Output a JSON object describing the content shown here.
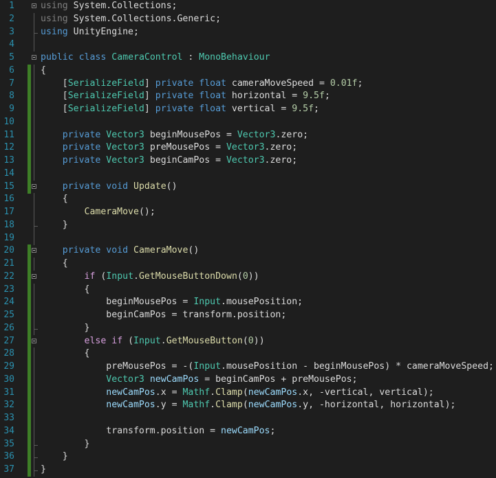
{
  "editor": {
    "language": "C#",
    "colors": {
      "background": "#1e1e1e",
      "line_number": "#2b91af",
      "keyword": "#569cd6",
      "type": "#4ec9b0",
      "number": "#b5cea8",
      "local": "#9cdcfe",
      "method": "#dcdcaa",
      "control": "#d8a0df",
      "changed_margin": "#3e7f27"
    },
    "lines": [
      {
        "n": "1",
        "tokens": [
          [
            "dim",
            "using"
          ],
          [
            "var",
            " System.Collections;"
          ]
        ]
      },
      {
        "n": "2",
        "tokens": [
          [
            "dim",
            "using"
          ],
          [
            "var",
            " System.Collections.Generic;"
          ]
        ]
      },
      {
        "n": "3",
        "tokens": [
          [
            "kw",
            "using"
          ],
          [
            "var",
            " UnityEngine;"
          ]
        ]
      },
      {
        "n": "4",
        "tokens": []
      },
      {
        "n": "5",
        "tokens": [
          [
            "kw",
            "public"
          ],
          [
            "var",
            " "
          ],
          [
            "kw",
            "class"
          ],
          [
            "var",
            " "
          ],
          [
            "ty",
            "CameraControl"
          ],
          [
            "var",
            " : "
          ],
          [
            "ty",
            "MonoBehaviour"
          ]
        ]
      },
      {
        "n": "6",
        "tokens": [
          [
            "var",
            "{"
          ]
        ]
      },
      {
        "n": "7",
        "tokens": [
          [
            "var",
            "    ["
          ],
          [
            "attr",
            "SerializeField"
          ],
          [
            "var",
            "] "
          ],
          [
            "kw",
            "private"
          ],
          [
            "var",
            " "
          ],
          [
            "kw",
            "float"
          ],
          [
            "var",
            " cameraMoveSpeed = "
          ],
          [
            "num",
            "0.01f"
          ],
          [
            "var",
            ";"
          ]
        ]
      },
      {
        "n": "8",
        "tokens": [
          [
            "var",
            "    ["
          ],
          [
            "attr",
            "SerializeField"
          ],
          [
            "var",
            "] "
          ],
          [
            "kw",
            "private"
          ],
          [
            "var",
            " "
          ],
          [
            "kw",
            "float"
          ],
          [
            "var",
            " horizontal = "
          ],
          [
            "num",
            "9.5f"
          ],
          [
            "var",
            ";"
          ]
        ]
      },
      {
        "n": "9",
        "tokens": [
          [
            "var",
            "    ["
          ],
          [
            "attr",
            "SerializeField"
          ],
          [
            "var",
            "] "
          ],
          [
            "kw",
            "private"
          ],
          [
            "var",
            " "
          ],
          [
            "kw",
            "float"
          ],
          [
            "var",
            " vertical = "
          ],
          [
            "num",
            "9.5f"
          ],
          [
            "var",
            ";"
          ]
        ]
      },
      {
        "n": "10",
        "tokens": []
      },
      {
        "n": "11",
        "tokens": [
          [
            "var",
            "    "
          ],
          [
            "kw",
            "private"
          ],
          [
            "var",
            " "
          ],
          [
            "ty",
            "Vector3"
          ],
          [
            "var",
            " beginMousePos = "
          ],
          [
            "ty",
            "Vector3"
          ],
          [
            "var",
            ".zero;"
          ]
        ]
      },
      {
        "n": "12",
        "tokens": [
          [
            "var",
            "    "
          ],
          [
            "kw",
            "private"
          ],
          [
            "var",
            " "
          ],
          [
            "ty",
            "Vector3"
          ],
          [
            "var",
            " preMousePos = "
          ],
          [
            "ty",
            "Vector3"
          ],
          [
            "var",
            ".zero;"
          ]
        ]
      },
      {
        "n": "13",
        "tokens": [
          [
            "var",
            "    "
          ],
          [
            "kw",
            "private"
          ],
          [
            "var",
            " "
          ],
          [
            "ty",
            "Vector3"
          ],
          [
            "var",
            " beginCamPos = "
          ],
          [
            "ty",
            "Vector3"
          ],
          [
            "var",
            ".zero;"
          ]
        ]
      },
      {
        "n": "14",
        "tokens": []
      },
      {
        "n": "15",
        "tokens": [
          [
            "var",
            "    "
          ],
          [
            "kw",
            "private"
          ],
          [
            "var",
            " "
          ],
          [
            "kw",
            "void"
          ],
          [
            "var",
            " "
          ],
          [
            "fn",
            "Update"
          ],
          [
            "var",
            "()"
          ]
        ]
      },
      {
        "n": "16",
        "tokens": [
          [
            "var",
            "    {"
          ]
        ]
      },
      {
        "n": "17",
        "tokens": [
          [
            "var",
            "        "
          ],
          [
            "fn",
            "CameraMove"
          ],
          [
            "var",
            "();"
          ]
        ]
      },
      {
        "n": "18",
        "tokens": [
          [
            "var",
            "    }"
          ]
        ]
      },
      {
        "n": "19",
        "tokens": []
      },
      {
        "n": "20",
        "tokens": [
          [
            "var",
            "    "
          ],
          [
            "kw",
            "private"
          ],
          [
            "var",
            " "
          ],
          [
            "kw",
            "void"
          ],
          [
            "var",
            " "
          ],
          [
            "fn",
            "CameraMove"
          ],
          [
            "var",
            "()"
          ]
        ]
      },
      {
        "n": "21",
        "tokens": [
          [
            "var",
            "    {"
          ]
        ]
      },
      {
        "n": "22",
        "tokens": [
          [
            "var",
            "        "
          ],
          [
            "ctl",
            "if"
          ],
          [
            "var",
            " ("
          ],
          [
            "ty",
            "Input"
          ],
          [
            "var",
            "."
          ],
          [
            "fn",
            "GetMouseButtonDown"
          ],
          [
            "var",
            "("
          ],
          [
            "num",
            "0"
          ],
          [
            "var",
            "))"
          ]
        ]
      },
      {
        "n": "23",
        "tokens": [
          [
            "var",
            "        {"
          ]
        ]
      },
      {
        "n": "24",
        "tokens": [
          [
            "var",
            "            beginMousePos = "
          ],
          [
            "ty",
            "Input"
          ],
          [
            "var",
            ".mousePosition;"
          ]
        ]
      },
      {
        "n": "25",
        "tokens": [
          [
            "var",
            "            beginCamPos = transform.position;"
          ]
        ]
      },
      {
        "n": "26",
        "tokens": [
          [
            "var",
            "        }"
          ]
        ]
      },
      {
        "n": "27",
        "tokens": [
          [
            "var",
            "        "
          ],
          [
            "ctl",
            "else"
          ],
          [
            "var",
            " "
          ],
          [
            "ctl",
            "if"
          ],
          [
            "var",
            " ("
          ],
          [
            "ty",
            "Input"
          ],
          [
            "var",
            "."
          ],
          [
            "fn",
            "GetMouseButton"
          ],
          [
            "var",
            "("
          ],
          [
            "num",
            "0"
          ],
          [
            "var",
            "))"
          ]
        ]
      },
      {
        "n": "28",
        "tokens": [
          [
            "var",
            "        {"
          ]
        ]
      },
      {
        "n": "29",
        "tokens": [
          [
            "var",
            "            preMousePos = -("
          ],
          [
            "ty",
            "Input"
          ],
          [
            "var",
            ".mousePosition - beginMousePos) * cameraMoveSpeed;"
          ]
        ]
      },
      {
        "n": "30",
        "tokens": [
          [
            "var",
            "            "
          ],
          [
            "ty",
            "Vector3"
          ],
          [
            "var",
            " "
          ],
          [
            "loc",
            "newCamPos"
          ],
          [
            "var",
            " = beginCamPos + preMousePos;"
          ]
        ]
      },
      {
        "n": "31",
        "tokens": [
          [
            "var",
            "            "
          ],
          [
            "loc",
            "newCamPos"
          ],
          [
            "var",
            ".x = "
          ],
          [
            "ty",
            "Mathf"
          ],
          [
            "var",
            "."
          ],
          [
            "fn",
            "Clamp"
          ],
          [
            "var",
            "("
          ],
          [
            "loc",
            "newCamPos"
          ],
          [
            "var",
            ".x, -vertical, vertical);"
          ]
        ]
      },
      {
        "n": "32",
        "tokens": [
          [
            "var",
            "            "
          ],
          [
            "loc",
            "newCamPos"
          ],
          [
            "var",
            ".y = "
          ],
          [
            "ty",
            "Mathf"
          ],
          [
            "var",
            "."
          ],
          [
            "fn",
            "Clamp"
          ],
          [
            "var",
            "("
          ],
          [
            "loc",
            "newCamPos"
          ],
          [
            "var",
            ".y, -horizontal, horizontal);"
          ]
        ]
      },
      {
        "n": "33",
        "tokens": []
      },
      {
        "n": "34",
        "tokens": [
          [
            "var",
            "            transform.position = "
          ],
          [
            "loc",
            "newCamPos"
          ],
          [
            "var",
            ";"
          ]
        ]
      },
      {
        "n": "35",
        "tokens": [
          [
            "var",
            "        }"
          ]
        ]
      },
      {
        "n": "36",
        "tokens": [
          [
            "var",
            "    }"
          ]
        ]
      },
      {
        "n": "37",
        "tokens": [
          [
            "var",
            "}"
          ]
        ]
      }
    ]
  }
}
